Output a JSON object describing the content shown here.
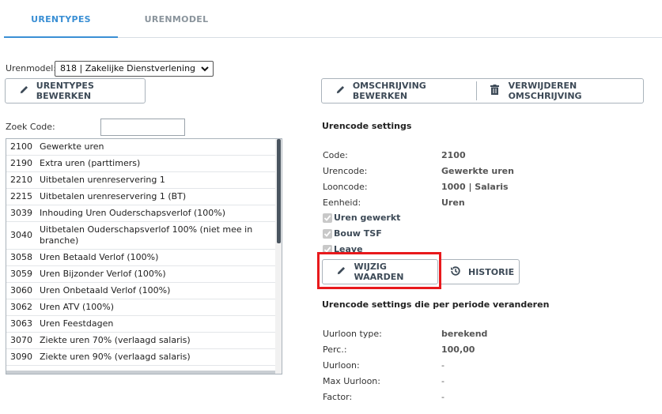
{
  "tabs": [
    {
      "label": "URENTYPES",
      "active": true
    },
    {
      "label": "URENMODEL",
      "active": false
    }
  ],
  "urenmodel": {
    "label": "Urenmodel:",
    "selected": "818 | Zakelijke Dienstverlening"
  },
  "buttons": {
    "urentypes_bewerken": "URENTYPES BEWERKEN",
    "omschrijving_bewerken": "OMSCHRIJVING BEWERKEN",
    "verwijderen_omschrijving": "VERWIJDEREN OMSCHRIJVING",
    "wijzig_waarden": "WIJZIG WAARDEN",
    "historie": "HISTORIE"
  },
  "search": {
    "label": "Zoek Code:",
    "value": ""
  },
  "codes": [
    {
      "code": "2100",
      "desc": "Gewerkte uren"
    },
    {
      "code": "2190",
      "desc": "Extra uren (parttimers)"
    },
    {
      "code": "2210",
      "desc": "Uitbetalen urenreservering 1"
    },
    {
      "code": "2215",
      "desc": "Uitbetalen urenreservering 1 (BT)"
    },
    {
      "code": "3039",
      "desc": "Inhouding Uren Ouderschapsverlof (100%)"
    },
    {
      "code": "3040",
      "desc": "Uitbetalen Ouderschapsverlof 100% (niet mee in branche)"
    },
    {
      "code": "3058",
      "desc": "Uren Betaald Verlof (100%)"
    },
    {
      "code": "3059",
      "desc": "Uren Bijzonder Verlof (100%)"
    },
    {
      "code": "3060",
      "desc": "Uren Onbetaald Verlof (100%)"
    },
    {
      "code": "3062",
      "desc": "Uren ATV (100%)"
    },
    {
      "code": "3063",
      "desc": "Uren Feestdagen"
    },
    {
      "code": "3070",
      "desc": "Ziekte uren 70% (verlaagd salaris)"
    },
    {
      "code": "3090",
      "desc": "Ziekte uren 90% (verlaagd salaris)"
    }
  ],
  "settings": {
    "title": "Urencode settings",
    "fields": [
      {
        "key": "Code:",
        "value": "2100"
      },
      {
        "key": "Urencode:",
        "value": "Gewerkte uren"
      },
      {
        "key": "Looncode:",
        "value": "1000 | Salaris"
      },
      {
        "key": "Eenheid:",
        "value": "Uren"
      }
    ],
    "checkboxes": [
      {
        "label": "Uren gewerkt",
        "checked": true
      },
      {
        "label": "Bouw TSF",
        "checked": true
      },
      {
        "label": "Leave",
        "checked": true
      }
    ]
  },
  "periode": {
    "title": "Urencode settings die per periode veranderen",
    "fields": [
      {
        "key": "Uurloon type:",
        "value": "berekend"
      },
      {
        "key": "Perc.:",
        "value": "100,00"
      },
      {
        "key": "Uurloon:",
        "value": "-"
      },
      {
        "key": "Max Uurloon:",
        "value": "-"
      },
      {
        "key": "Factor:",
        "value": "-"
      }
    ]
  },
  "colors": {
    "accent": "#3a8fd4",
    "highlight": "#e8191c"
  }
}
